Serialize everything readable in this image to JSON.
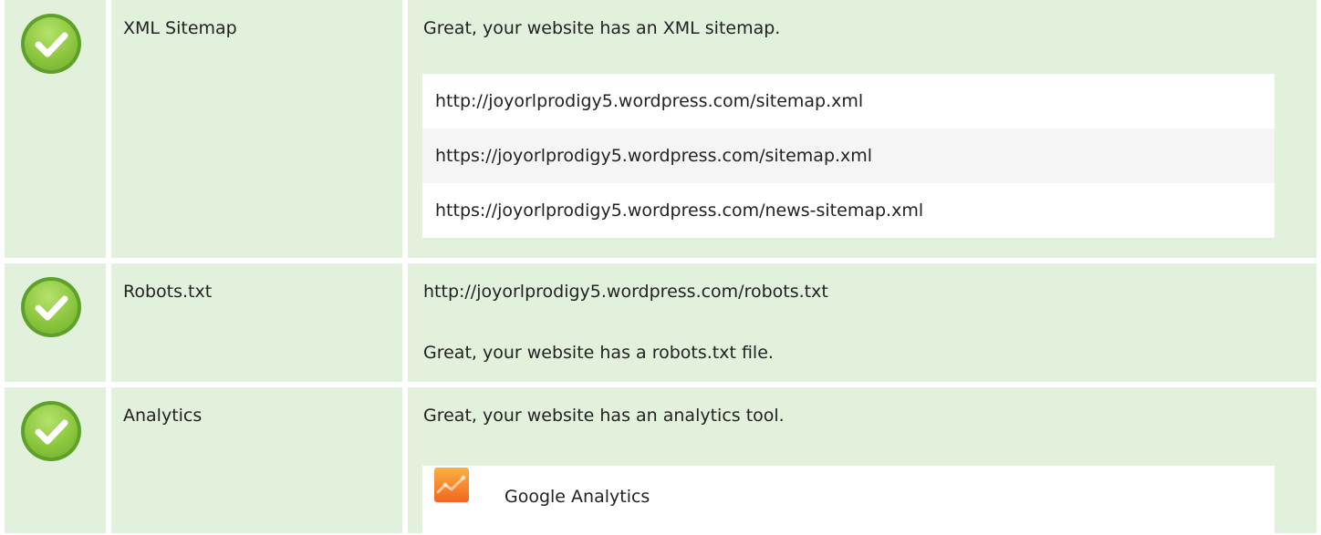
{
  "rows": [
    {
      "label": "XML Sitemap",
      "status_icon": "check-circle-icon",
      "message": "Great, your website has an XML sitemap.",
      "sitemaps": [
        "http://joyorlprodigy5.wordpress.com/sitemap.xml",
        "https://joyorlprodigy5.wordpress.com/sitemap.xml",
        "https://joyorlprodigy5.wordpress.com/news-sitemap.xml"
      ]
    },
    {
      "label": "Robots.txt",
      "status_icon": "check-circle-icon",
      "url": "http://joyorlprodigy5.wordpress.com/robots.txt",
      "message": "Great, your website has a robots.txt file."
    },
    {
      "label": "Analytics",
      "status_icon": "check-circle-icon",
      "message": "Great, your website has an analytics tool.",
      "tools": [
        {
          "name": "Google Analytics",
          "icon": "google-analytics-icon"
        }
      ]
    }
  ],
  "colors": {
    "row_background": "#e1f1db",
    "check_green": "#8cc63f",
    "analytics_orange": "#f7931e"
  }
}
